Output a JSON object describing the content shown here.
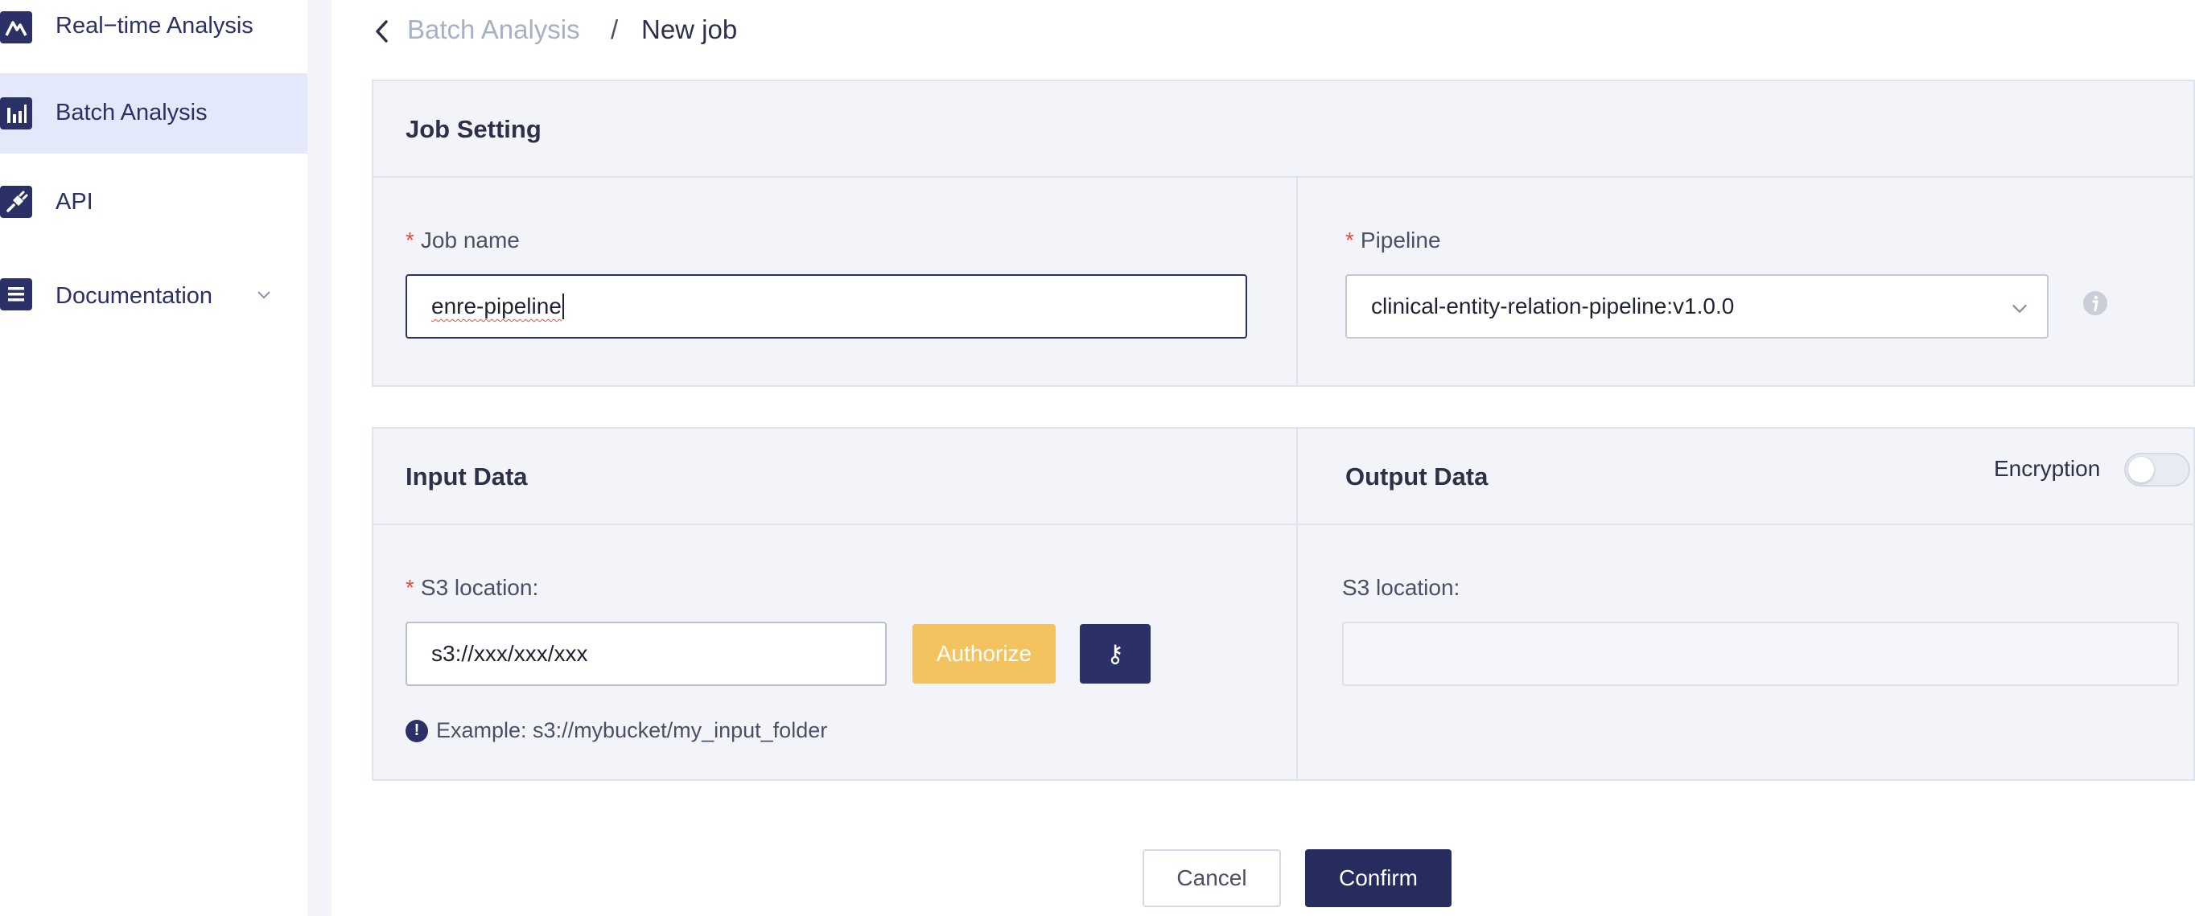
{
  "sidebar": {
    "items": [
      {
        "label": "Real−time Analysis",
        "icon": "mountain-chart-icon"
      },
      {
        "label": "Batch Analysis",
        "icon": "bar-chart-icon",
        "active": true
      },
      {
        "label": "API",
        "icon": "plug-icon"
      },
      {
        "label": "Documentation",
        "icon": "document-list-icon",
        "expandable": true
      }
    ]
  },
  "breadcrumb": {
    "parent": "Batch Analysis",
    "separator": "/",
    "current": "New job"
  },
  "job_setting": {
    "title": "Job Setting",
    "job_name": {
      "required_mark": "*",
      "label": "Job name",
      "value": "enre-pipeline"
    },
    "pipeline": {
      "required_mark": "*",
      "label": "Pipeline",
      "value": "clinical-entity-relation-pipeline:v1.0.0"
    }
  },
  "input_data": {
    "title": "Input Data",
    "s3": {
      "required_mark": "*",
      "label": "S3 location:",
      "value": "s3://xxx/xxx/xxx"
    },
    "authorize_label": "Authorize",
    "key_glyph": "⚷",
    "hint": "Example: s3://mybucket/my_input_folder",
    "hint_icon": "!"
  },
  "output_data": {
    "title": "Output Data",
    "encryption_label": "Encryption",
    "encryption_enabled": false,
    "s3": {
      "label": "S3 location:",
      "value": ""
    }
  },
  "actions": {
    "cancel_label": "Cancel",
    "confirm_label": "Confirm"
  },
  "colors": {
    "brand_navy": "#2b3066",
    "required": "#e4503b",
    "authorize": "#f3c360",
    "panel_bg": "#f2f4fa",
    "active_nav": "#e3e9fa"
  }
}
